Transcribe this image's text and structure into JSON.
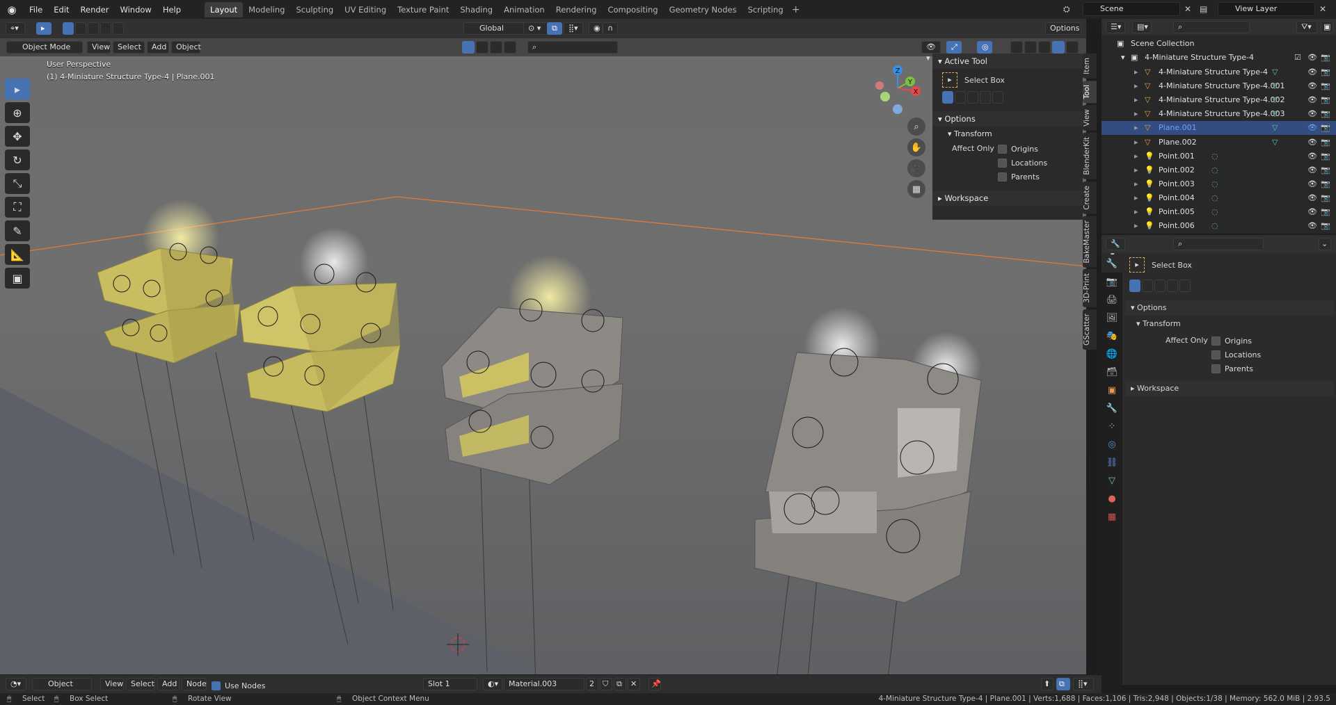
{
  "menu": [
    "File",
    "Edit",
    "Render",
    "Window",
    "Help"
  ],
  "workspaces": [
    "Layout",
    "Modeling",
    "Sculpting",
    "UV Editing",
    "Texture Paint",
    "Shading",
    "Animation",
    "Rendering",
    "Compositing",
    "Geometry Nodes",
    "Scripting"
  ],
  "active_workspace": "Layout",
  "scene": "Scene",
  "view_layer": "View Layer",
  "viewport": {
    "mode": "Object Mode",
    "menus": [
      "View",
      "Select",
      "Add",
      "Object"
    ],
    "transform_orientation": "Global",
    "options_label": "Options",
    "perspective": "User Perspective",
    "active_info": "(1) 4-Miniature Structure Type-4 | Plane.001"
  },
  "gizmo_axes": [
    "Z",
    "Y",
    "X"
  ],
  "npanel": {
    "active_tool_title": "Active Tool",
    "tool_name": "Select Box",
    "options_title": "Options",
    "transform_title": "Transform",
    "affect_only_label": "Affect Only",
    "checkboxes": [
      "Origins",
      "Locations",
      "Parents"
    ],
    "workspace_title": "Workspace",
    "side_tabs": [
      "Item",
      "Tool",
      "View",
      "BlenderKit",
      "Create",
      "BakeMaster",
      "3D-Print",
      "GScatter"
    ]
  },
  "outliner": {
    "root": "Scene Collection",
    "collection": "4-Miniature Structure Type-4",
    "items": [
      {
        "name": "4-Miniature Structure Type-4",
        "icon": "mesh-icon",
        "selected": false
      },
      {
        "name": "4-Miniature Structure Type-4.001",
        "icon": "mesh-icon",
        "selected": false
      },
      {
        "name": "4-Miniature Structure Type-4.002",
        "icon": "mesh-icon",
        "selected": false
      },
      {
        "name": "4-Miniature Structure Type-4.003",
        "icon": "mesh-icon",
        "selected": false
      },
      {
        "name": "Plane.001",
        "icon": "mesh-icon",
        "selected": true
      },
      {
        "name": "Plane.002",
        "icon": "mesh-icon",
        "selected": false
      },
      {
        "name": "Point.001",
        "icon": "light-icon",
        "selected": false
      },
      {
        "name": "Point.002",
        "icon": "light-icon",
        "selected": false
      },
      {
        "name": "Point.003",
        "icon": "light-icon",
        "selected": false
      },
      {
        "name": "Point.004",
        "icon": "light-icon",
        "selected": false
      },
      {
        "name": "Point.005",
        "icon": "light-icon",
        "selected": false
      },
      {
        "name": "Point.006",
        "icon": "light-icon",
        "selected": false
      }
    ]
  },
  "properties": {
    "tool_name": "Select Box",
    "options_title": "Options",
    "transform_title": "Transform",
    "affect_only_label": "Affect Only",
    "checkboxes": [
      "Origins",
      "Locations",
      "Parents"
    ],
    "workspace_title": "Workspace"
  },
  "shader_header": {
    "editor": "Object",
    "menus": [
      "View",
      "Select",
      "Add",
      "Node"
    ],
    "use_nodes_label": "Use Nodes",
    "slot": "Slot 1",
    "material": "Material.003",
    "users": "2"
  },
  "status": {
    "select": "Select",
    "box_select": "Box Select",
    "rotate_view": "Rotate View",
    "context_menu": "Object Context Menu",
    "stats": "4-Miniature Structure Type-4 | Plane.001 | Verts:1,688 | Faces:1,106 | Tris:2,948 | Objects:1/38 | Memory: 562.0 MiB | 2.93.5"
  },
  "colors": {
    "accent": "#4772b3",
    "selection_outline": "#e07a3a",
    "structure_yellow": "#c9bd62",
    "structure_concrete": "#8a8580"
  }
}
